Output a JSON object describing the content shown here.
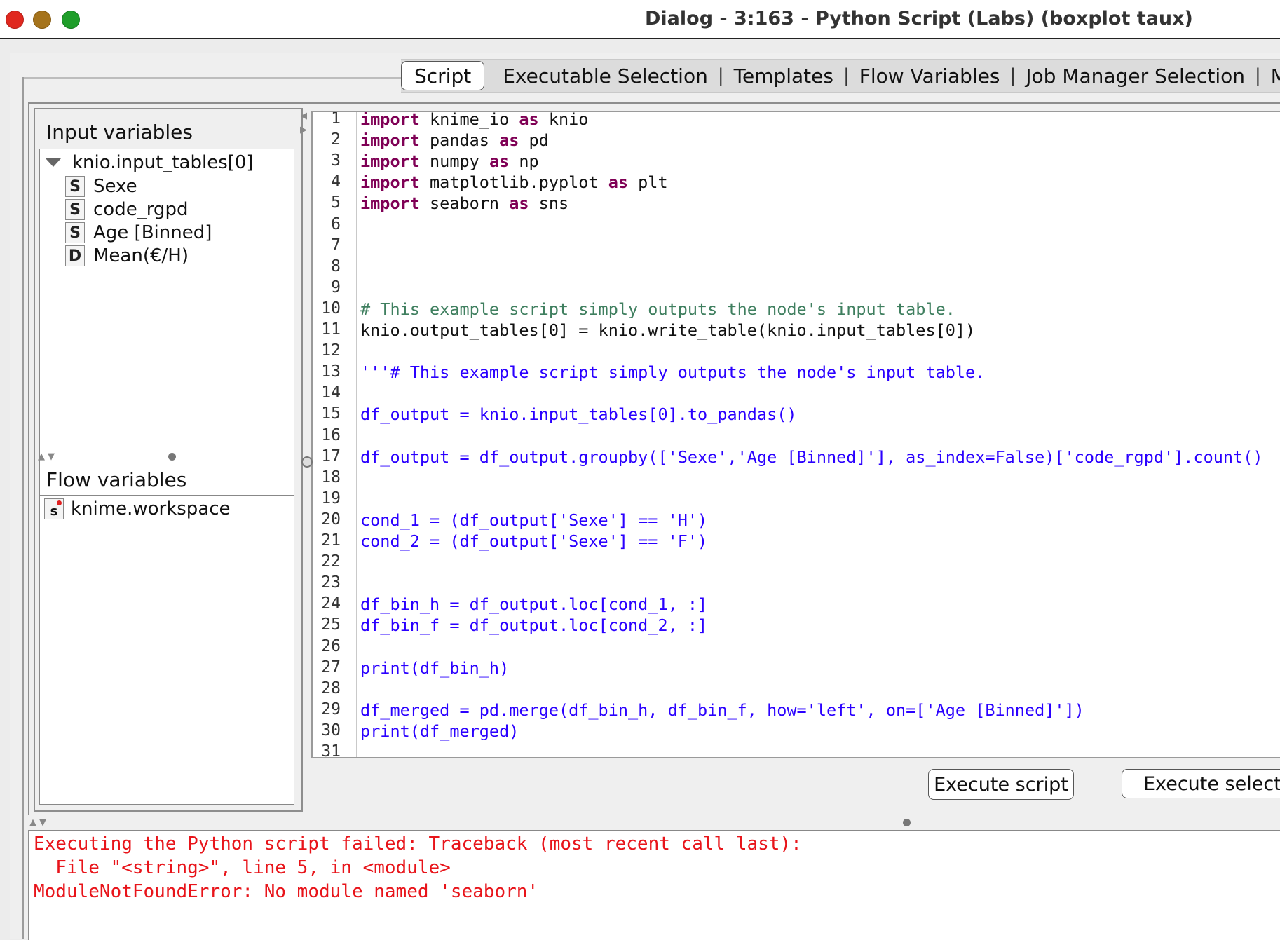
{
  "window": {
    "title": "Dialog - 3:163 - Python Script (Labs) (boxplot taux)"
  },
  "tabs": [
    {
      "label": "Script",
      "active": true
    },
    {
      "label": "Executable Selection"
    },
    {
      "label": "Templates"
    },
    {
      "label": "Flow Variables"
    },
    {
      "label": "Job Manager Selection"
    },
    {
      "label": "Memor"
    }
  ],
  "tab_separator": "|",
  "input_variables": {
    "header": "Input variables",
    "table": "knio.input_tables[0]",
    "columns": [
      {
        "type": "S",
        "name": "Sexe"
      },
      {
        "type": "S",
        "name": "code_rgpd"
      },
      {
        "type": "S",
        "name": "Age [Binned]"
      },
      {
        "type": "D",
        "name": "Mean(€/H)"
      }
    ]
  },
  "flow_variables": {
    "header": "Flow variables",
    "items": [
      {
        "type": "s",
        "name": "knime.workspace"
      }
    ]
  },
  "editor": {
    "lines": [
      "import knime_io as knio",
      "import pandas as pd",
      "import numpy as np",
      "import matplotlib.pyplot as plt",
      "import seaborn as sns",
      "",
      "",
      "",
      "",
      "# This example script simply outputs the node's input table.",
      "knio.output_tables[0] = knio.write_table(knio.input_tables[0])",
      "",
      "'''# This example script simply outputs the node's input table.",
      "",
      "df_output = knio.input_tables[0].to_pandas()",
      "",
      "df_output = df_output.groupby(['Sexe','Age [Binned]'], as_index=False)['code_rgpd'].count()",
      "",
      "",
      "cond_1 = (df_output['Sexe'] == 'H')",
      "cond_2 = (df_output['Sexe'] == 'F')",
      "",
      "",
      "df_bin_h = df_output.loc[cond_1, :]",
      "df_bin_f = df_output.loc[cond_2, :]",
      "",
      "print(df_bin_h)",
      "",
      "df_merged = pd.merge(df_bin_h, df_bin_f, how='left', on=['Age [Binned]'])",
      "print(df_merged)",
      ""
    ],
    "line_numbers": [
      "1",
      "2",
      "3",
      "4",
      "5",
      "6",
      "7",
      "8",
      "9",
      "10",
      "11",
      "12",
      "13",
      "14",
      "15",
      "16",
      "17",
      "18",
      "19",
      "20",
      "21",
      "22",
      "23",
      "24",
      "25",
      "26",
      "27",
      "28",
      "29",
      "30",
      "31"
    ]
  },
  "buttons": {
    "execute_script": "Execute script",
    "execute_selected": "Execute selecte"
  },
  "console": {
    "lines": [
      "Executing the Python script failed: Traceback (most recent call last):",
      "  File \"<string>\", line 5, in <module>",
      "ModuleNotFoundError: No module named 'seaborn'"
    ]
  },
  "colors": {
    "keyword": "#7f0055",
    "comment": "#3f7f5f",
    "string_block": "#2a00ff",
    "error": "#e8141a"
  }
}
